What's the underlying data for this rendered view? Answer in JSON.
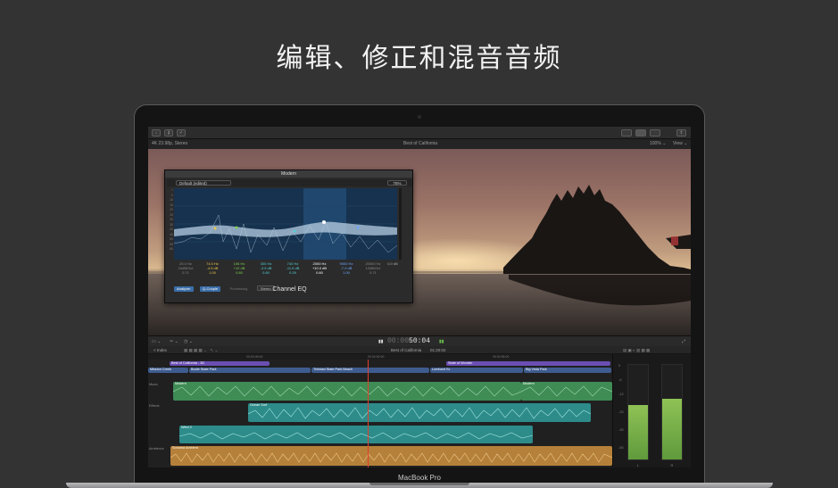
{
  "headline": "编辑、修正和混音音频",
  "device_label": "MacBook Pro",
  "app": {
    "toolbar": {
      "import_icon": "download-icon",
      "keyword_icon": "key-icon",
      "bg_tasks_icon": "gear-icon",
      "share_icon": "share-icon"
    },
    "viewer_bar": {
      "format": "4K 23.98p, Stereo",
      "project_name": "Best of California",
      "zoom": "100% ⌄",
      "view": "View ⌄"
    },
    "eq_plugin": {
      "window_title": "Modern",
      "preset": "Default (edited)",
      "percent": "76%",
      "name": "Channel EQ",
      "db_scale": [
        "+",
        "0",
        "10",
        "15",
        "20",
        "25",
        "30",
        "35",
        "40",
        "45",
        "50",
        "55",
        "60"
      ],
      "freq_labels": [
        "20",
        "50",
        "100",
        "200",
        "500",
        "1k",
        "2k",
        "5k",
        "10k",
        "20k"
      ],
      "bands": [
        {
          "freq": "20.0 Hz",
          "gain": "24dB/Oct",
          "q": "0.71"
        },
        {
          "freq": "74.0 Hz",
          "gain": "-4.5 dB",
          "q": "1.00"
        },
        {
          "freq": "106 Hz",
          "gain": "+10 dB",
          "q": "0.80"
        },
        {
          "freq": "300 Hz",
          "gain": "-3.5 dB",
          "q": "0.80"
        },
        {
          "freq": "740 Hz",
          "gain": "-11.5 dB",
          "q": "0.39"
        },
        {
          "freq": "2000 Hz",
          "gain": "+10.0 dB",
          "q": "0.80"
        },
        {
          "freq": "9000 Hz",
          "gain": "-7.0 dB",
          "q": "1.00"
        },
        {
          "freq": "20000 Hz",
          "gain": "12dB/Oct",
          "q": "0.71"
        }
      ],
      "output_gain": "0.0 dB",
      "buttons": {
        "analyzer": "Analyzer",
        "qcouple": "Q-Couple",
        "processing_label": "Processing",
        "processing": "Stereo"
      }
    },
    "transport": {
      "timecode_dim": "00:00",
      "timecode": "50:04",
      "play_icon": "play-icon"
    },
    "timeline": {
      "index_label": "< Index",
      "project": "Best of California",
      "duration": "01:20:02",
      "ruler": [
        "00:00:45:00",
        "00:00:50:00",
        "00:00:55:00"
      ],
      "title_clips": [
        "Best of California - 3D",
        "State of Wonder"
      ],
      "video_clips": [
        "Mission Creek",
        "Bodie State Park",
        "Trinidad State Park Beach",
        "Lombard St.",
        "Big Vista Park"
      ],
      "roles": [
        "Music",
        "Effects",
        "Ambience"
      ],
      "audio_clips": [
        "Modern",
        "Modern",
        "Ocean Surf",
        "Wind 2",
        "Sonoma Ambient"
      ]
    },
    "meters": {
      "scale": [
        "0",
        "-6",
        "-12",
        "-20",
        "-30",
        "-50"
      ],
      "channels": [
        {
          "label": "L",
          "level": 0.58
        },
        {
          "label": "R",
          "level": 0.64
        }
      ]
    }
  },
  "colors": {
    "music": "#4fa866",
    "effects": "#3aa2a0",
    "ambience": "#c38a3a",
    "title": "#6a4fb3",
    "video": "#3e5c8f"
  }
}
